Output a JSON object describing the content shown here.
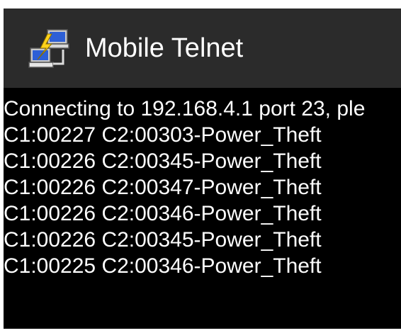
{
  "app_bar": {
    "title": "Mobile Telnet",
    "icon": "network-lightning-icon"
  },
  "terminal": {
    "lines": [
      "Connecting to 192.168.4.1 port 23, ple",
      "C1:00227 C2:00303-Power_Theft",
      "C1:00226 C2:00345-Power_Theft",
      "C1:00226 C2:00347-Power_Theft",
      "C1:00226 C2:00346-Power_Theft",
      "C1:00226 C2:00345-Power_Theft",
      "C1:00225 C2:00346-Power_Theft"
    ]
  },
  "colors": {
    "app_bar_background": "#2b2b2b",
    "terminal_background": "#000000",
    "terminal_text": "#ffffff",
    "title_text": "#ffffff"
  }
}
